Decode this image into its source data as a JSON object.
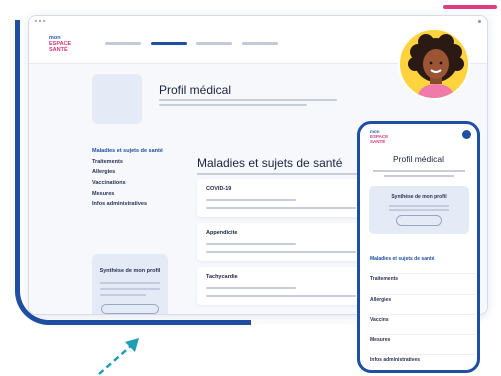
{
  "brand": {
    "logo_line1": "mon",
    "logo_line2": "ESPACE",
    "logo_line3": "SANTÉ",
    "primary_color": "#1e4fa3",
    "accent_color": "#e23b7d"
  },
  "desktop": {
    "profile_title": "Profil médical",
    "sidebar": {
      "items": [
        "Maladies et sujets de santé",
        "Traitements",
        "Allergies",
        "Vaccinations",
        "Mesures",
        "Infos administratives"
      ],
      "active_index": 0
    },
    "synthesis_card_title": "Synthèse de mon profil",
    "main_title": "Maladies et sujets de santé",
    "cards": [
      "COVID-19",
      "Appendicite",
      "Tachycardie"
    ]
  },
  "phone": {
    "profile_title": "Profil médical",
    "synthesis_card_title": "Synthèse de mon profil",
    "menu": [
      "Maladies et sujets de santé",
      "Traitements",
      "Allergies",
      "Vaccins",
      "Mesures",
      "Infos administratives"
    ],
    "active_index": 0
  },
  "icons": {
    "avatar": "user-avatar-illustration",
    "arrow": "diagonal-arrow-icon"
  }
}
